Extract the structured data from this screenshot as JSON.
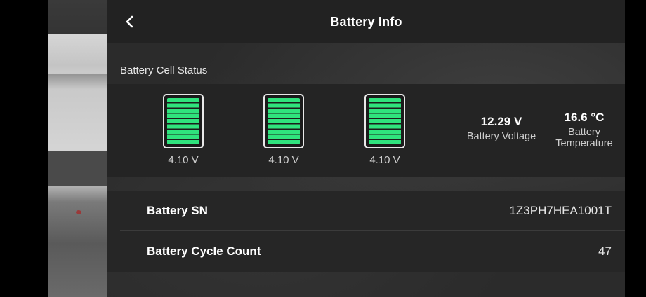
{
  "header": {
    "title": "Battery Info"
  },
  "cell_status": {
    "section_label": "Battery Cell Status",
    "cells": [
      {
        "voltage": "4.10 V",
        "level_fraction": 1.0
      },
      {
        "voltage": "4.10 V",
        "level_fraction": 1.0
      },
      {
        "voltage": "4.10 V",
        "level_fraction": 1.0
      }
    ],
    "battery_voltage": {
      "value": "12.29 V",
      "label": "Battery Voltage"
    },
    "battery_temperature": {
      "value": "16.6 °C",
      "label_line1": "Battery",
      "label_line2": "Temperature"
    }
  },
  "info": {
    "sn": {
      "label": "Battery SN",
      "value": "1Z3PH7HEA1001T"
    },
    "cycle_count": {
      "label": "Battery Cycle Count",
      "value": "47"
    }
  },
  "colors": {
    "cell_fill": "#2fe37d",
    "panel_bg": "#2b2b2b",
    "header_bg": "#222222"
  },
  "icons": {
    "back": "chevron-left-icon",
    "battery": "battery-full-icon"
  }
}
